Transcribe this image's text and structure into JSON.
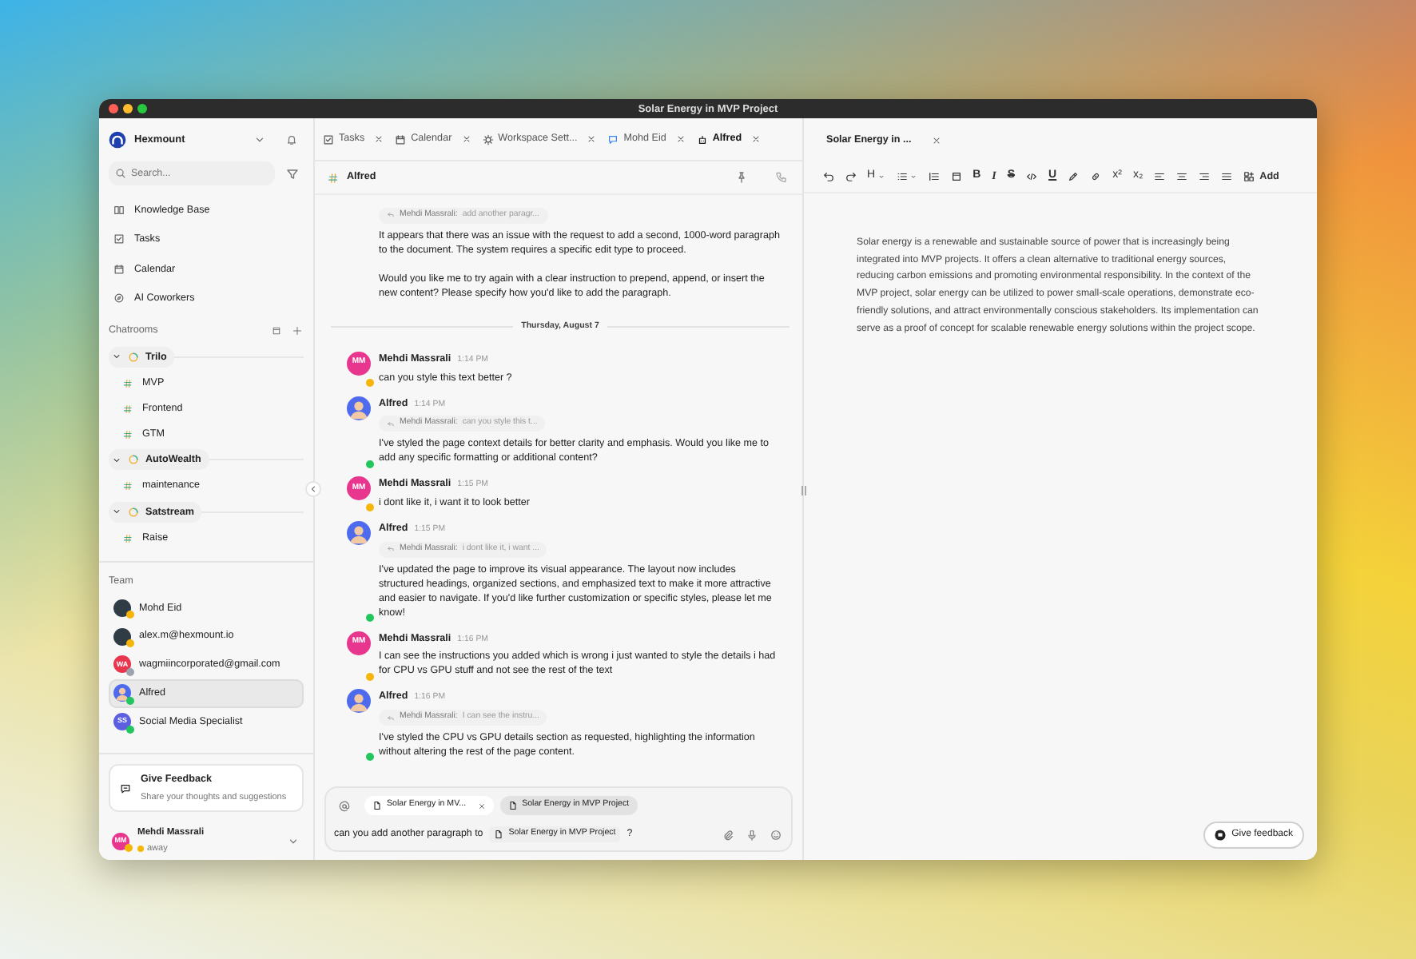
{
  "window": {
    "title": "Solar Energy in MVP Project"
  },
  "sidebar": {
    "workspace": "Hexmount",
    "search": {
      "placeholder": "Search..."
    },
    "nav": [
      {
        "label": "Knowledge Base"
      },
      {
        "label": "Tasks"
      },
      {
        "label": "Calendar"
      },
      {
        "label": "AI Coworkers"
      }
    ],
    "chatrooms": {
      "title": "Chatrooms",
      "groups": [
        {
          "name": "Trilo",
          "expanded": true,
          "channels": [
            {
              "name": "MVP"
            },
            {
              "name": "Frontend"
            },
            {
              "name": "GTM"
            }
          ]
        },
        {
          "name": "AutoWealth",
          "expanded": true,
          "channels": [
            {
              "name": "maintenance"
            }
          ]
        },
        {
          "name": "Satstream",
          "expanded": true,
          "channels": [
            {
              "name": "Raise"
            }
          ]
        }
      ]
    },
    "team": {
      "title": "Team",
      "members": [
        {
          "name": "Mohd Eid",
          "avatar": {
            "kind": "photo"
          },
          "status_dot": {
            "color": "#f5b50a"
          },
          "selected": false
        },
        {
          "name": "alex.m@hexmount.io",
          "avatar": {
            "kind": "photo"
          },
          "status_dot": {
            "color": "#f5b50a"
          },
          "selected": false
        },
        {
          "name": "wagmiincorporated@gmail.com",
          "avatar": {
            "kind": "initials",
            "initials": "WA",
            "color": "#e8364f"
          },
          "status_dot": {
            "color": "#9ca3af"
          },
          "selected": false
        },
        {
          "name": "Alfred",
          "avatar": {
            "kind": "bot"
          },
          "status_dot": {
            "color": "#22c55e"
          },
          "selected": true
        },
        {
          "name": "Social Media Specialist",
          "avatar": {
            "kind": "initials",
            "initials": "SS",
            "color": "#5b5fe0"
          },
          "status_dot": {
            "color": "#22c55e"
          },
          "selected": false
        }
      ]
    },
    "feedback": {
      "title": "Give Feedback",
      "subtitle": "Share your thoughts and suggestions"
    },
    "user": {
      "name": "Mehdi Massrali",
      "avatar": {
        "kind": "initials",
        "initials": "MM",
        "color": "#e8368f"
      },
      "status_dot": {
        "color": "#f5b50a"
      },
      "status_text": "away"
    }
  },
  "tabs": [
    {
      "label": "Tasks",
      "selected": false
    },
    {
      "label": "Calendar",
      "selected": false
    },
    {
      "label": "Workspace Sett...",
      "selected": false
    },
    {
      "label": "Mohd Eid",
      "selected": false
    },
    {
      "label": "Alfred",
      "selected": true
    }
  ],
  "chat": {
    "channel": "Alfred",
    "messages": [
      {
        "kind": "continuation",
        "quote": {
          "author": "Mehdi Massrali:",
          "text": "add another paragr..."
        },
        "text": [
          "It appears that there was an issue with the request to add a second, 1000-word paragraph to the document. The system requires a specific edit type to proceed.",
          "Would you like me to try again with a clear instruction to prepend, append, or insert the new content? Please specify how you'd like to add the paragraph."
        ]
      },
      {
        "kind": "divider",
        "label": "Thursday, August 7"
      },
      {
        "kind": "message",
        "author": "Mehdi Massrali",
        "time": "1:14 PM",
        "avatar": {
          "kind": "initials",
          "initials": "MM",
          "color": "#e8368f"
        },
        "status_dot": {
          "color": "#f5b50a"
        },
        "text": [
          "can you style this text better ?"
        ]
      },
      {
        "kind": "message",
        "author": "Alfred",
        "time": "1:14 PM",
        "avatar": {
          "kind": "bot"
        },
        "status_dot": {
          "color": "#22c55e"
        },
        "quote": {
          "author": "Mehdi Massrali:",
          "text": "can you style this t..."
        },
        "text": [
          "I've styled the page context details for better clarity and emphasis. Would you like me to add any specific formatting or additional content?"
        ]
      },
      {
        "kind": "message",
        "author": "Mehdi Massrali",
        "time": "1:15 PM",
        "avatar": {
          "kind": "initials",
          "initials": "MM",
          "color": "#e8368f"
        },
        "status_dot": {
          "color": "#f5b50a"
        },
        "text": [
          "i dont like it, i want it to look better"
        ]
      },
      {
        "kind": "message",
        "author": "Alfred",
        "time": "1:15 PM",
        "avatar": {
          "kind": "bot"
        },
        "status_dot": {
          "color": "#22c55e"
        },
        "quote": {
          "author": "Mehdi Massrali:",
          "text": "i dont like it, i want ..."
        },
        "text": [
          "I've updated the page to improve its visual appearance. The layout now includes structured headings, organized sections, and emphasized text to make it more attractive and easier to navigate. If you'd like further customization or specific styles, please let me know!"
        ]
      },
      {
        "kind": "message",
        "author": "Mehdi Massrali",
        "time": "1:16 PM",
        "avatar": {
          "kind": "initials",
          "initials": "MM",
          "color": "#e8368f"
        },
        "status_dot": {
          "color": "#f5b50a"
        },
        "text": [
          "I can see the instructions you added which is wrong i just wanted to style the details i had for CPU vs GPU stuff and not see the rest of the text"
        ]
      },
      {
        "kind": "message",
        "author": "Alfred",
        "time": "1:16 PM",
        "avatar": {
          "kind": "bot"
        },
        "status_dot": {
          "color": "#22c55e"
        },
        "quote": {
          "author": "Mehdi Massrali:",
          "text": "I can see the instru..."
        },
        "text": [
          "I've styled the CPU vs GPU details section as requested, highlighting the information without altering the rest of the page content."
        ]
      }
    ]
  },
  "composer": {
    "chips": [
      {
        "label": "Solar Energy in MV...",
        "removable": true,
        "selected": false
      },
      {
        "label": "Solar Energy in MVP Project",
        "removable": false,
        "selected": true
      }
    ],
    "message": [
      {
        "kind": "text",
        "text": "can you add another paragraph to"
      },
      {
        "kind": "mention",
        "text": "Solar Energy in MVP Project"
      },
      {
        "kind": "text",
        "text": "?"
      }
    ]
  },
  "editor": {
    "tab": {
      "label": "Solar Energy in ...",
      "selected": true
    },
    "toolbar": [
      {
        "kind": "icon"
      },
      {
        "kind": "icon"
      },
      {
        "kind": "glyph",
        "text": "H",
        "dropdown": true
      },
      {
        "kind": "icon",
        "dropdown": true
      },
      {
        "kind": "icon"
      },
      {
        "kind": "icon"
      },
      {
        "kind": "bold",
        "text": "B"
      },
      {
        "kind": "italic",
        "text": "I"
      },
      {
        "kind": "strike",
        "text": "S"
      },
      {
        "kind": "icon"
      },
      {
        "kind": "underline",
        "text": "U"
      },
      {
        "kind": "icon"
      },
      {
        "kind": "icon"
      },
      {
        "kind": "glyph",
        "text": "x²"
      },
      {
        "kind": "glyph",
        "text": "x₂"
      },
      {
        "kind": "icon"
      },
      {
        "kind": "icon"
      },
      {
        "kind": "icon"
      },
      {
        "kind": "icon"
      },
      {
        "kind": "button",
        "text": "Add"
      }
    ],
    "body": "Solar energy is a renewable and sustainable source of power that is increasingly being integrated into MVP projects. It offers a clean alternative to traditional energy sources, reducing carbon emissions and promoting environmental responsibility. In the context of the MVP project, solar energy can be utilized to power small-scale operations, demonstrate eco-friendly solutions, and attract environmentally conscious stakeholders. Its implementation can serve as a proof of concept for scalable renewable energy solutions within the project scope.",
    "feedback_button": "Give feedback"
  }
}
